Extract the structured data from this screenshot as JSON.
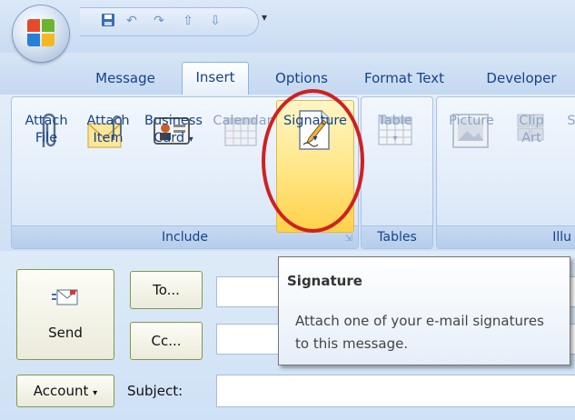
{
  "quick_access": {
    "icons": [
      "save-icon",
      "undo-icon",
      "redo-icon",
      "up-arrow-icon",
      "down-arrow-icon"
    ],
    "dropdown_glyph": "▾"
  },
  "tabs": [
    {
      "label": "Message",
      "active": false
    },
    {
      "label": "Insert",
      "active": true
    },
    {
      "label": "Options",
      "active": false
    },
    {
      "label": "Format Text",
      "active": false
    },
    {
      "label": "Developer",
      "active": false
    }
  ],
  "ribbon": {
    "groups": {
      "include": "Include",
      "tables": "Tables",
      "illustrations": "Illu"
    },
    "buttons": {
      "attach_file": [
        "Attach",
        "File"
      ],
      "attach_item": [
        "Attach",
        "Item"
      ],
      "business_card": [
        "Business",
        "Card"
      ],
      "calendar": "Calendar",
      "signature": "Signature",
      "table": "Table",
      "picture": "Picture",
      "clip_art": [
        "Clip",
        "Art"
      ],
      "cut_off": "S"
    },
    "dropdown_glyph": "▾"
  },
  "form": {
    "send": "Send",
    "to": "To...",
    "cc": "Cc...",
    "account": "Account",
    "subject_label": "Subject:",
    "to_value": "",
    "cc_value": "",
    "subject_value": ""
  },
  "tooltip": {
    "title": "Signature",
    "body": "Attach one of your e-mail signatures to this message."
  },
  "colors": {
    "accent": "#15428b",
    "highlight_oval": "#d02020",
    "signature_hover": "#ffe78a"
  }
}
